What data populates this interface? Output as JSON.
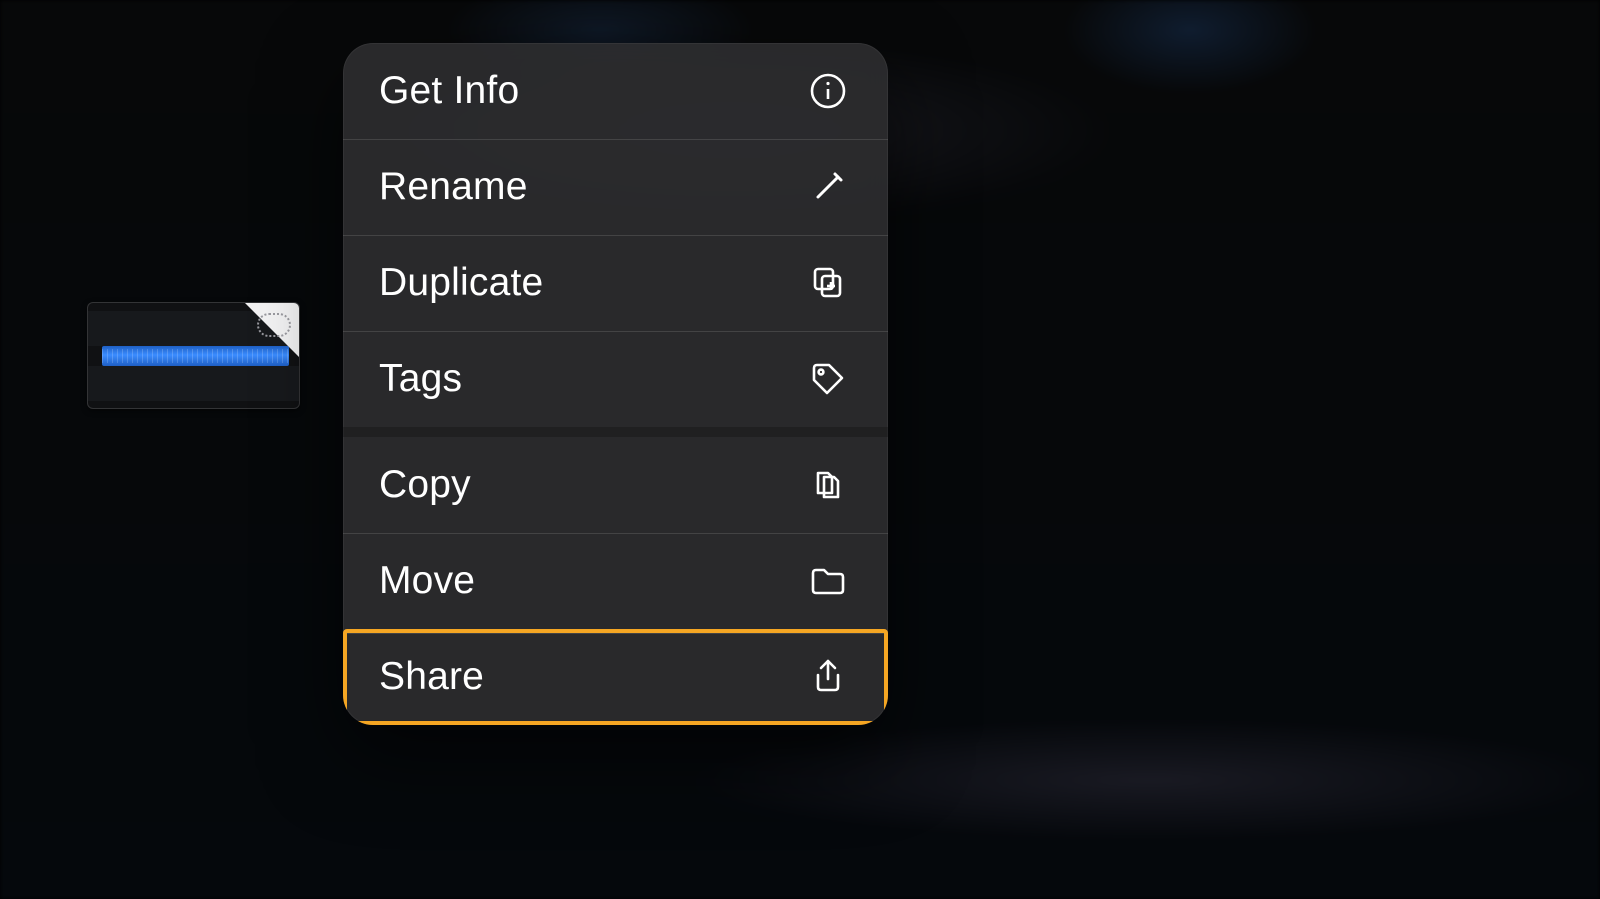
{
  "context_menu": {
    "groups": [
      {
        "items": [
          {
            "key": "get_info",
            "label": "Get Info",
            "icon": "info-icon",
            "highlighted": false
          },
          {
            "key": "rename",
            "label": "Rename",
            "icon": "pencil-icon",
            "highlighted": false
          },
          {
            "key": "duplicate",
            "label": "Duplicate",
            "icon": "duplicate-icon",
            "highlighted": false
          },
          {
            "key": "tags",
            "label": "Tags",
            "icon": "tag-icon",
            "highlighted": false
          }
        ]
      },
      {
        "items": [
          {
            "key": "copy",
            "label": "Copy",
            "icon": "copy-icon",
            "highlighted": false
          },
          {
            "key": "move",
            "label": "Move",
            "icon": "folder-icon",
            "highlighted": false
          },
          {
            "key": "share",
            "label": "Share",
            "icon": "share-icon",
            "highlighted": true
          }
        ]
      }
    ]
  },
  "thumbnail": {
    "kind": "audio-project",
    "sync_state": "cloud-pending"
  },
  "colors": {
    "highlight_border": "#f5a623",
    "menu_bg": "#2c2c2f",
    "text": "#ffffff"
  }
}
